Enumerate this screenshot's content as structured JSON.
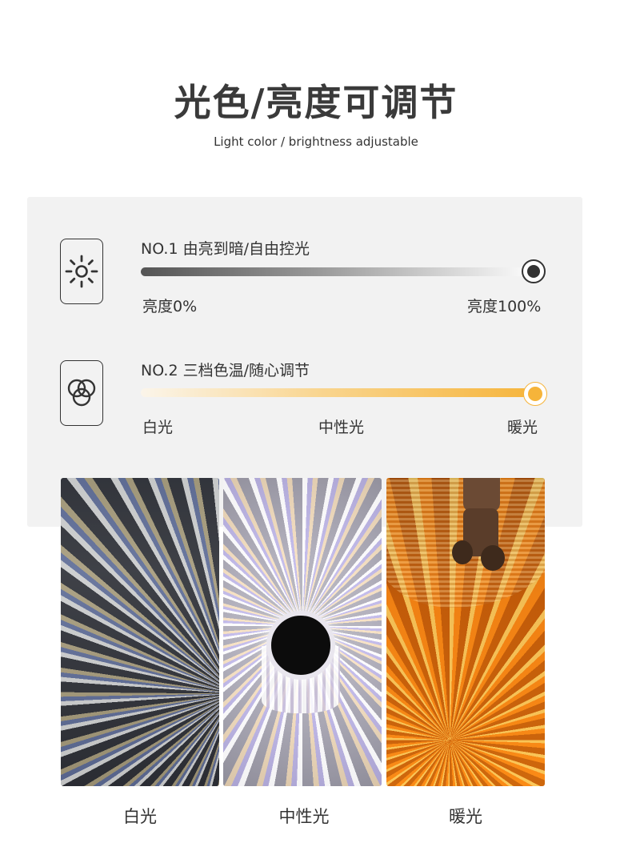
{
  "header": {
    "title": "光色/亮度可调节",
    "subtitle": "Light color / brightness adjustable"
  },
  "features": [
    {
      "label": "NO.1 由亮到暗/自由控光",
      "icon": "sun-icon",
      "slider_value_percent": 100,
      "min_label": "亮度0%",
      "max_label": "亮度100%"
    },
    {
      "label": "NO.2 三档色温/随心调节",
      "icon": "color-circles-icon",
      "slider_value_percent": 100,
      "stops": [
        "白光",
        "中性光",
        "暖光"
      ]
    }
  ],
  "photos": [
    {
      "caption": "白光"
    },
    {
      "caption": "中性光"
    },
    {
      "caption": "暖光"
    }
  ],
  "colors": {
    "panel_bg": "#f2f2f2",
    "warm_accent": "#f6b43a",
    "dark": "#333333"
  }
}
